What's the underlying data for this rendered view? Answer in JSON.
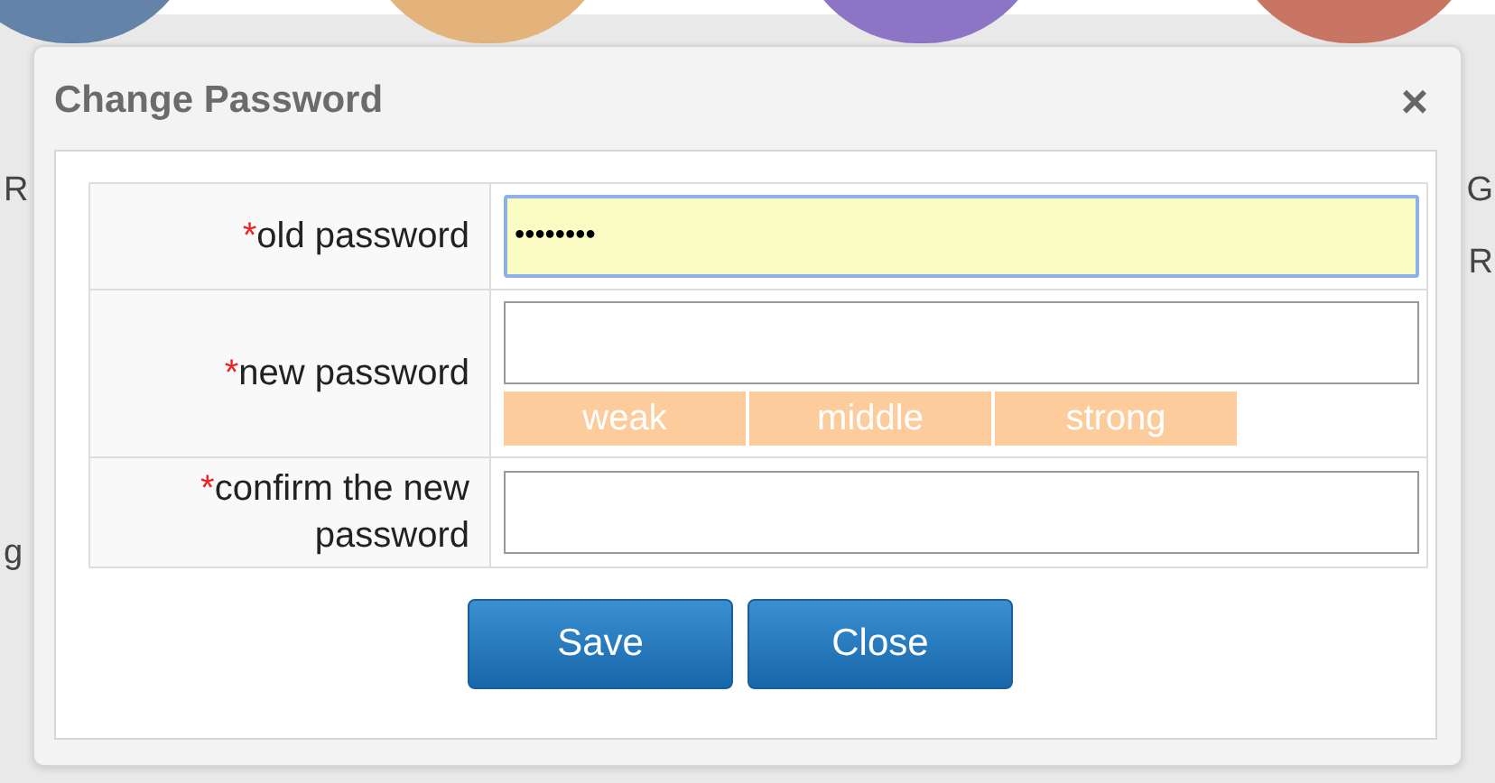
{
  "background": {
    "tiles": [
      {
        "color": "#6383a8"
      },
      {
        "color": "#e3b37b"
      },
      {
        "color": "#8e74c5"
      },
      {
        "color": "#c97563"
      }
    ],
    "left_fragments": [
      "R",
      "g"
    ],
    "right_fragments": [
      "G",
      "R"
    ]
  },
  "dialog": {
    "title": "Change Password",
    "close": "×"
  },
  "fields": [
    {
      "kind": "input",
      "required_mark": "*",
      "label": "old password",
      "value": "••••••••",
      "focused": true
    },
    {
      "kind": "strength",
      "required_mark": "*",
      "label": "new password",
      "focused": false,
      "strength_levels": [
        {
          "label": "weak",
          "active": false
        },
        {
          "label": "middle",
          "active": false
        },
        {
          "label": "strong",
          "active": false
        }
      ]
    },
    {
      "kind": "input",
      "required_mark": "*",
      "label": "confirm the new password",
      "focused": false
    }
  ],
  "buttons": [
    "Save",
    "Close"
  ]
}
